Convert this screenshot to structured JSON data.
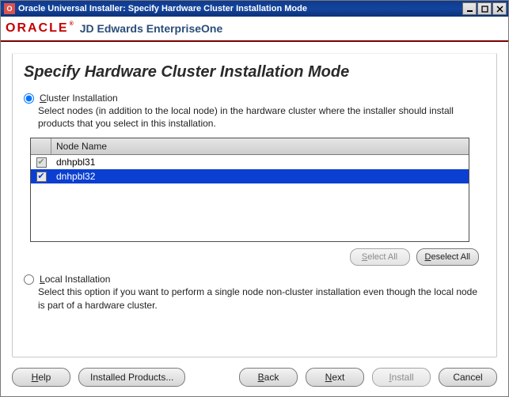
{
  "window": {
    "title": "Oracle Universal Installer: Specify Hardware Cluster Installation Mode"
  },
  "brand": {
    "logo": "ORACLE",
    "product": "JD Edwards EnterpriseOne"
  },
  "page": {
    "heading": "Specify Hardware Cluster Installation Mode"
  },
  "cluster": {
    "radio_label_pre": "C",
    "radio_label_post": "luster Installation",
    "description": "Select nodes (in addition to the local node) in the hardware cluster where the installer should install products that you select in this installation.",
    "column_header": "Node Name",
    "nodes": [
      {
        "name": "dnhpbl31",
        "checked": true,
        "locked": true,
        "selected": false
      },
      {
        "name": "dnhpbl32",
        "checked": true,
        "locked": false,
        "selected": true
      }
    ],
    "select_all_pre": "S",
    "select_all_post": "elect All",
    "deselect_all_pre": "D",
    "deselect_all_post": "eselect All"
  },
  "local": {
    "radio_label_pre": "L",
    "radio_label_post": "ocal Installation",
    "description": "Select this option if you want to perform a single node non-cluster installation even though the local node is part of a hardware cluster."
  },
  "footer": {
    "help_pre": "H",
    "help_post": "elp",
    "installed_products": "Installed Products...",
    "back_pre": "B",
    "back_post": "ack",
    "next_pre": "N",
    "next_post": "ext",
    "install_pre": "I",
    "install_post": "nstall",
    "cancel": "Cancel"
  }
}
